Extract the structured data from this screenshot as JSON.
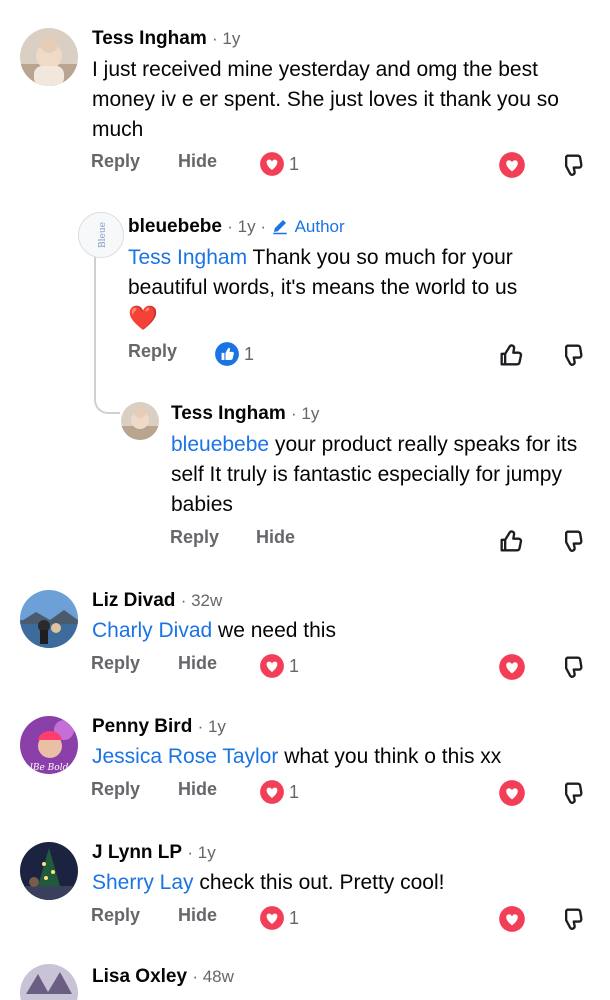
{
  "labels": {
    "reply": "Reply",
    "hide": "Hide"
  },
  "comments": [
    {
      "author": "Tess Ingham",
      "time": "· 1y",
      "text": "I just received mine yesterday and omg the best money iv e er spent. She just loves it thank you so much",
      "reactions": "1",
      "reaction_type": "love"
    },
    {
      "author": "bleuebebe",
      "time": "· 1y ·",
      "badge": "Author",
      "mention": "Tess Ingham",
      "text": " Thank you so much for your beautiful words, it's means the world to us",
      "emoji": "❤️",
      "reactions": "1",
      "reaction_type": "like"
    },
    {
      "author": "Tess Ingham",
      "time": "· 1y",
      "mention": "bleuebebe",
      "text": " your product really speaks for its self   It truly is fantastic especially for jumpy babies"
    },
    {
      "author": "Liz Divad",
      "time": "· 32w",
      "mention": "Charly Divad",
      "text": " we need this",
      "reactions": "1",
      "reaction_type": "love"
    },
    {
      "author": "Penny Bird",
      "time": "· 1y",
      "mention": "Jessica Rose Taylor",
      "text": " what you think o this xx",
      "reactions": "1",
      "reaction_type": "love"
    },
    {
      "author": "J Lynn LP",
      "time": "· 1y",
      "mention": "Sherry Lay",
      "text": " check this out. Pretty cool!",
      "reactions": "1",
      "reaction_type": "love"
    },
    {
      "author": "Lisa Oxley",
      "time": "· 48w"
    }
  ],
  "colors": {
    "love": "#f33e58",
    "like": "#1b74e4",
    "mention": "#1b74e4",
    "muted": "#65676b"
  },
  "icons": [
    "love-reaction-icon",
    "like-reaction-icon",
    "heart-button-icon",
    "thumbs-down-icon",
    "thumbs-up-icon",
    "pencil-icon"
  ]
}
